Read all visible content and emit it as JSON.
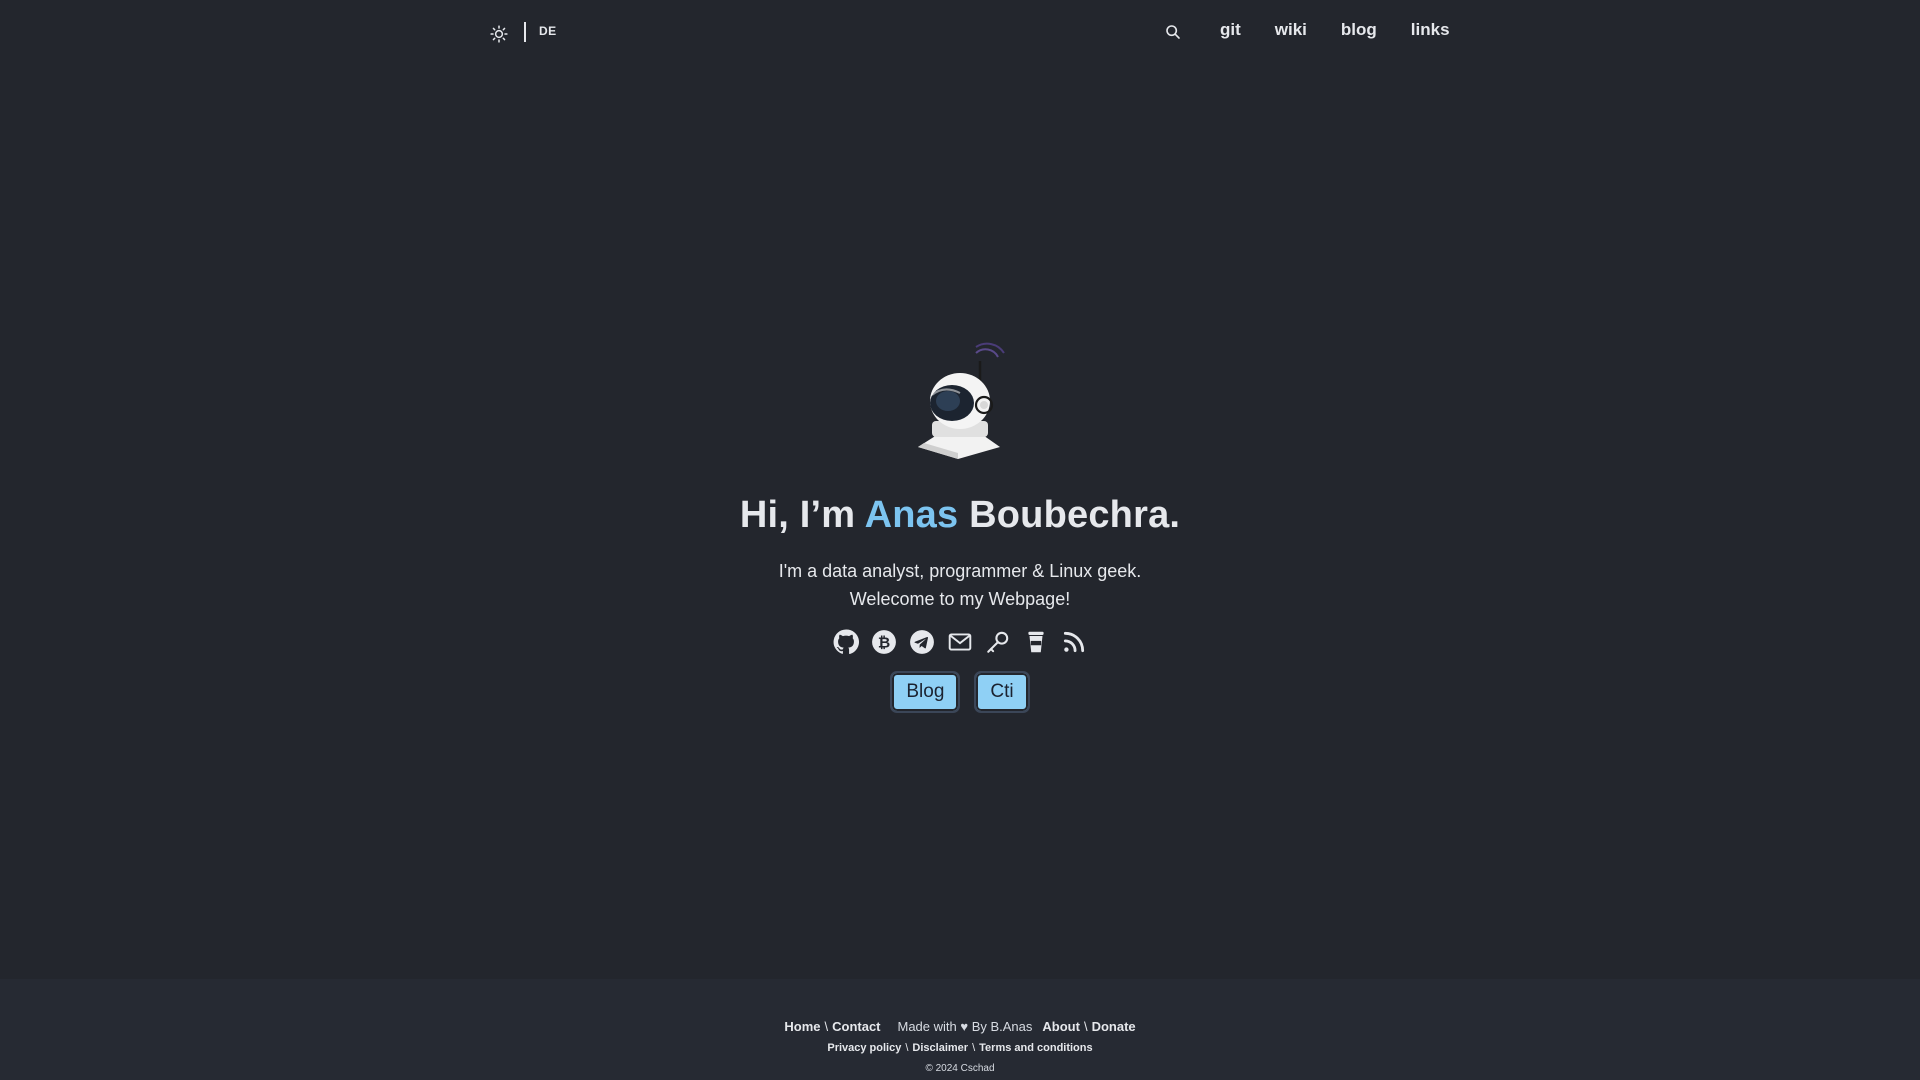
{
  "header": {
    "theme_icon": "sun-icon",
    "lang_label": "DE",
    "search_icon": "search-icon",
    "nav": [
      {
        "label": "git"
      },
      {
        "label": "wiki"
      },
      {
        "label": "blog"
      },
      {
        "label": "links"
      }
    ]
  },
  "hero": {
    "avatar": "astronaut-helmet-logo",
    "greeting_prefix": "Hi, I’m ",
    "first_name": "Anas",
    "last_name": " Boubechra.",
    "tagline_line1": "I'm a data analyst, programmer & Linux geek.",
    "tagline_line2": "Welecome to my Webpage!",
    "socials": [
      "github-icon",
      "bitcoin-icon",
      "telegram-icon",
      "email-icon",
      "key-icon",
      "coffee-icon",
      "rss-icon"
    ],
    "buttons": [
      {
        "label": "Blog"
      },
      {
        "label": "Cti"
      }
    ]
  },
  "footer": {
    "home": "Home",
    "contact": "Contact",
    "made_with": "Made with ♥ By B.Anas",
    "about": "About",
    "donate": "Donate",
    "privacy": "Privacy policy",
    "disclaimer": "Disclaimer",
    "terms": "Terms and conditions",
    "copyright": "© 2024 Cschad",
    "separator": "\\"
  },
  "colors": {
    "background": "#23262d",
    "footer_bg": "#262a33",
    "accent": "#7cc4f0",
    "button_bg": "#8fd0f5",
    "text": "#e6e8ec"
  }
}
